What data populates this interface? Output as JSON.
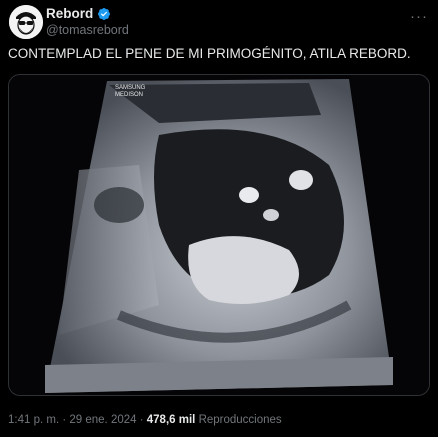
{
  "author": {
    "name": "Rebord",
    "handle": "@tomasrebord",
    "verified": true,
    "more_icon": "more-dots-icon"
  },
  "tweet": {
    "text": "CONTEMPLAD EL PENE DE MI PRIMOGÉNITO, ATILA REBORD."
  },
  "media": {
    "label_top": "SAMSUNG",
    "label_bottom": "MEDISON"
  },
  "footer": {
    "time": "1:41 p. m.",
    "sep1": " · ",
    "date": "29 ene. 2024",
    "sep2": " · ",
    "views_count": "478,6 mil",
    "views_label": "Reproducciones"
  },
  "colors": {
    "verified_badge": "#1d9bf0",
    "muted_text": "#71767b",
    "main_text": "#e7e9ea"
  }
}
